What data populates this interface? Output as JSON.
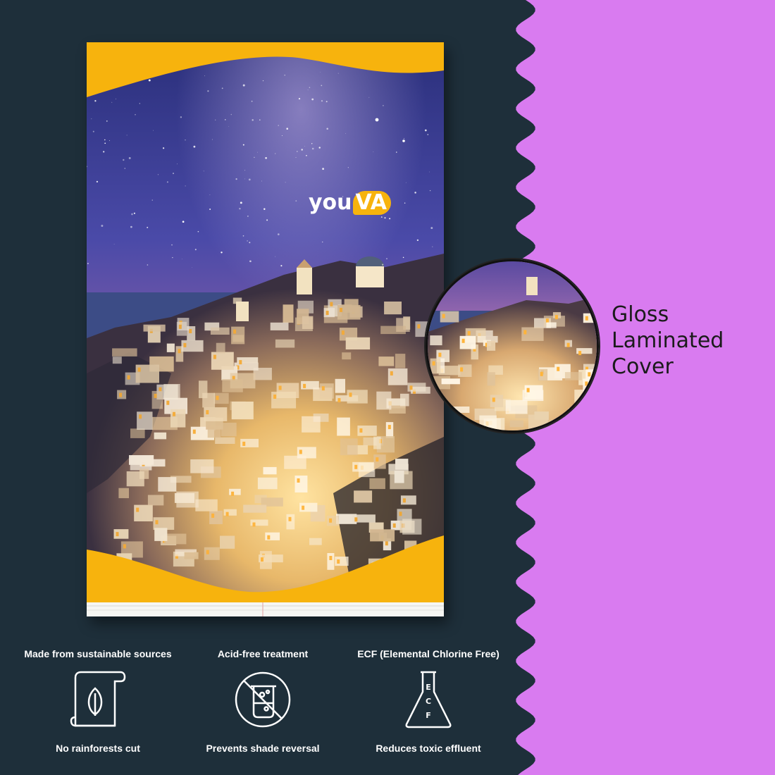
{
  "brand": {
    "you": "you",
    "va": "VA",
    "accent_color": "#f7b30d"
  },
  "colors": {
    "left_background": "#1e2f3a",
    "right_background": "#d97bf0",
    "cover_accent": "#f7b30d"
  },
  "zoom_callout": {
    "lines": [
      "Gloss",
      "Laminated",
      "Cover"
    ]
  },
  "features": [
    {
      "title": "Made from sustainable sources",
      "icon": "leaf-scroll-icon",
      "subtitle": "No rainforests cut"
    },
    {
      "title": "Acid-free treatment",
      "icon": "no-chemical-beaker-icon",
      "subtitle": "Prevents shade reversal"
    },
    {
      "title": "ECF (Elemental Chlorine Free)",
      "icon": "ecf-flask-icon",
      "subtitle": "Reduces toxic effluent"
    }
  ]
}
